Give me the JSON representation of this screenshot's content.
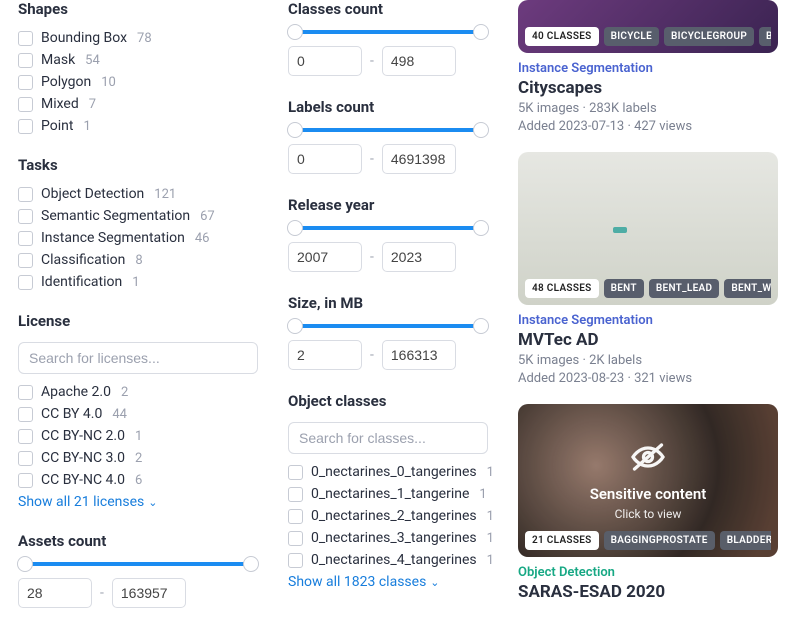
{
  "filters": {
    "shapes": {
      "title": "Shapes",
      "items": [
        {
          "label": "Bounding Box",
          "count": "78"
        },
        {
          "label": "Mask",
          "count": "54"
        },
        {
          "label": "Polygon",
          "count": "10"
        },
        {
          "label": "Mixed",
          "count": "7"
        },
        {
          "label": "Point",
          "count": "1"
        }
      ]
    },
    "tasks": {
      "title": "Tasks",
      "items": [
        {
          "label": "Object Detection",
          "count": "121"
        },
        {
          "label": "Semantic Segmentation",
          "count": "67"
        },
        {
          "label": "Instance Segmentation",
          "count": "46"
        },
        {
          "label": "Classification",
          "count": "8"
        },
        {
          "label": "Identification",
          "count": "1"
        }
      ]
    },
    "license": {
      "title": "License",
      "search_placeholder": "Search for licenses...",
      "items": [
        {
          "label": "Apache 2.0",
          "count": "2"
        },
        {
          "label": "CC BY 4.0",
          "count": "44"
        },
        {
          "label": "CC BY-NC 2.0",
          "count": "1"
        },
        {
          "label": "CC BY-NC 3.0",
          "count": "2"
        },
        {
          "label": "CC BY-NC 4.0",
          "count": "6"
        }
      ],
      "show_all": "Show all 21 licenses"
    },
    "assets_count": {
      "title": "Assets count",
      "min": "28",
      "max": "163957"
    },
    "classes_count": {
      "title": "Classes count",
      "min": "0",
      "max": "498"
    },
    "labels_count": {
      "title": "Labels count",
      "min": "0",
      "max": "4691398"
    },
    "release_year": {
      "title": "Release year",
      "min": "2007",
      "max": "2023"
    },
    "size_mb": {
      "title": "Size, in MB",
      "min": "2",
      "max": "166313"
    },
    "object_classes": {
      "title": "Object classes",
      "search_placeholder": "Search for classes...",
      "items": [
        {
          "label": "0_nectarines_0_tangerines",
          "count": "1"
        },
        {
          "label": "0_nectarines_1_tangerine",
          "count": "1"
        },
        {
          "label": "0_nectarines_2_tangerines",
          "count": "1"
        },
        {
          "label": "0_nectarines_3_tangerines",
          "count": "1"
        },
        {
          "label": "0_nectarines_4_tangerines",
          "count": "1"
        }
      ],
      "show_all": "Show all 1823 classes"
    }
  },
  "dash": "-",
  "sensitive": {
    "title": "Sensitive content",
    "subtitle": "Click to view"
  },
  "cards": [
    {
      "classes_badge": "40 CLASSES",
      "tags": [
        "BICYCLE",
        "BICYCLEGROUP",
        "BRIDGE"
      ],
      "category": "Instance Segmentation",
      "title": "Cityscapes",
      "sub1": "5K images · 283K labels",
      "sub2": "Added 2023-07-13 · 427 views"
    },
    {
      "classes_badge": "48 CLASSES",
      "tags": [
        "BENT",
        "BENT_LEAD",
        "BENT_WIRE"
      ],
      "category": "Instance Segmentation",
      "title": "MVTec AD",
      "sub1": "5K images · 2K labels",
      "sub2": "Added 2023-08-23 · 321 views"
    },
    {
      "classes_badge": "21 CLASSES",
      "tags": [
        "BAGGINGPROSTATE",
        "BLADDERANASTO"
      ],
      "category": "Object Detection",
      "title": "SARAS-ESAD 2020"
    }
  ]
}
